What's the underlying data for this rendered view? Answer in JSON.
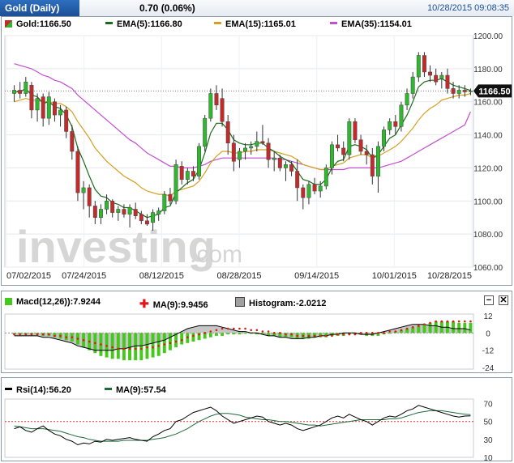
{
  "header": {
    "title": "Gold (Daily)",
    "change": "0.70 (0.06%)",
    "timestamp": "10/28/2015 09:08:35"
  },
  "main_legend": {
    "price": "Gold:1166.50",
    "ema5": "EMA(5):1166.80",
    "ema15": "EMA(15):1165.01",
    "ema35": "EMA(35):1154.01"
  },
  "price_tag": "1166.50",
  "watermark": {
    "brand": "investing",
    "suffix": ".com"
  },
  "macd_legend": {
    "macd": "Macd(12,26)):7.9244",
    "ma": "MA(9):9.9456",
    "histogram": "Histogram:-2.0212"
  },
  "rsi_legend": {
    "rsi": "Rsi(14):56.20",
    "ma": "MA(9):57.54"
  },
  "controls": {
    "minus": "−",
    "close": "✕"
  },
  "colors": {
    "up": "#2db82d",
    "down": "#c42a2a",
    "ema5": "#1a6b1a",
    "ema15": "#d4a020",
    "ema35": "#c24fd0",
    "histogram": "#45c81c",
    "macd_signal": "#e01818",
    "rsi": "#000000",
    "rsi_ma": "#1e6b3a",
    "title_bg": "#1e5aa8"
  },
  "chart_data": [
    {
      "type": "candlestick",
      "title": "Gold (Daily)",
      "ylim": [
        1060,
        1200
      ],
      "yticks": [
        1060,
        1080,
        1100,
        1120,
        1140,
        1160,
        1180,
        1200
      ],
      "xticks": [
        "07/02/2015",
        "07/24/2015",
        "08/12/2015",
        "08/28/2015",
        "09/14/2015",
        "10/01/2015",
        "10/28/2015"
      ],
      "last_price": 1166.5,
      "ohlc": [
        [
          1165,
          1170,
          1160,
          1167
        ],
        [
          1167,
          1172,
          1162,
          1165
        ],
        [
          1165,
          1175,
          1163,
          1172
        ],
        [
          1170,
          1172,
          1150,
          1155
        ],
        [
          1155,
          1165,
          1148,
          1162
        ],
        [
          1163,
          1165,
          1145,
          1150
        ],
        [
          1150,
          1166,
          1146,
          1163
        ],
        [
          1160,
          1162,
          1148,
          1152
        ],
        [
          1152,
          1158,
          1145,
          1155
        ],
        [
          1155,
          1157,
          1138,
          1142
        ],
        [
          1142,
          1146,
          1125,
          1130
        ],
        [
          1130,
          1133,
          1100,
          1105
        ],
        [
          1105,
          1112,
          1095,
          1108
        ],
        [
          1108,
          1110,
          1090,
          1097
        ],
        [
          1097,
          1100,
          1086,
          1090
        ],
        [
          1090,
          1098,
          1086,
          1095
        ],
        [
          1095,
          1104,
          1092,
          1100
        ],
        [
          1100,
          1101,
          1090,
          1093
        ],
        [
          1093,
          1097,
          1088,
          1095
        ],
        [
          1095,
          1098,
          1090,
          1092
        ],
        [
          1092,
          1098,
          1084,
          1096
        ],
        [
          1095,
          1099,
          1089,
          1091
        ],
        [
          1092,
          1094,
          1086,
          1088
        ],
        [
          1088,
          1092,
          1085,
          1086
        ],
        [
          1087,
          1095,
          1082,
          1093
        ],
        [
          1092,
          1096,
          1088,
          1094
        ],
        [
          1094,
          1106,
          1092,
          1104
        ],
        [
          1104,
          1108,
          1098,
          1100
        ],
        [
          1100,
          1125,
          1098,
          1122
        ],
        [
          1121,
          1124,
          1110,
          1113
        ],
        [
          1113,
          1120,
          1110,
          1118
        ],
        [
          1118,
          1121,
          1112,
          1115
        ],
        [
          1115,
          1135,
          1113,
          1133
        ],
        [
          1133,
          1152,
          1130,
          1150
        ],
        [
          1150,
          1168,
          1148,
          1165
        ],
        [
          1165,
          1170,
          1155,
          1158
        ],
        [
          1162,
          1168,
          1145,
          1148
        ],
        [
          1148,
          1152,
          1128,
          1135
        ],
        [
          1135,
          1140,
          1118,
          1124
        ],
        [
          1125,
          1132,
          1120,
          1130
        ],
        [
          1130,
          1135,
          1125,
          1132
        ],
        [
          1132,
          1136,
          1128,
          1133
        ],
        [
          1133,
          1142,
          1130,
          1136
        ],
        [
          1136,
          1146,
          1134,
          1135
        ],
        [
          1135,
          1138,
          1120,
          1125
        ],
        [
          1125,
          1130,
          1118,
          1126
        ],
        [
          1126,
          1128,
          1118,
          1120
        ],
        [
          1120,
          1124,
          1112,
          1122
        ],
        [
          1122,
          1124,
          1115,
          1118
        ],
        [
          1118,
          1125,
          1100,
          1108
        ],
        [
          1108,
          1110,
          1095,
          1102
        ],
        [
          1102,
          1112,
          1098,
          1110
        ],
        [
          1110,
          1114,
          1104,
          1106
        ],
        [
          1106,
          1112,
          1102,
          1109
        ],
        [
          1109,
          1122,
          1107,
          1120
        ],
        [
          1120,
          1136,
          1116,
          1134
        ],
        [
          1134,
          1140,
          1130,
          1132
        ],
        [
          1132,
          1136,
          1124,
          1128
        ],
        [
          1128,
          1150,
          1125,
          1148
        ],
        [
          1148,
          1150,
          1135,
          1137
        ],
        [
          1137,
          1140,
          1128,
          1130
        ],
        [
          1130,
          1134,
          1122,
          1128
        ],
        [
          1128,
          1132,
          1110,
          1115
        ],
        [
          1115,
          1136,
          1105,
          1133
        ],
        [
          1133,
          1145,
          1130,
          1143
        ],
        [
          1143,
          1150,
          1140,
          1148
        ],
        [
          1148,
          1152,
          1140,
          1145
        ],
        [
          1145,
          1160,
          1142,
          1158
        ],
        [
          1158,
          1168,
          1155,
          1165
        ],
        [
          1165,
          1178,
          1162,
          1175
        ],
        [
          1175,
          1190,
          1172,
          1188
        ],
        [
          1188,
          1190,
          1175,
          1178
        ],
        [
          1178,
          1182,
          1172,
          1176
        ],
        [
          1176,
          1180,
          1170,
          1172
        ],
        [
          1174,
          1178,
          1168,
          1176
        ],
        [
          1176,
          1180,
          1165,
          1168
        ],
        [
          1168,
          1172,
          1162,
          1165
        ],
        [
          1165,
          1170,
          1162,
          1167
        ],
        [
          1167,
          1170,
          1163,
          1166
        ],
        [
          1166,
          1168,
          1164,
          1166.5
        ]
      ],
      "series": [
        {
          "name": "EMA(5)",
          "values": [
            1166,
            1166,
            1168,
            1164,
            1163,
            1159,
            1160,
            1157,
            1156,
            1152,
            1145,
            1132,
            1124,
            1115,
            1107,
            1103,
            1102,
            1099,
            1098,
            1096,
            1096,
            1094,
            1092,
            1090,
            1091,
            1092,
            1096,
            1097,
            1105,
            1108,
            1111,
            1113,
            1119,
            1129,
            1141,
            1147,
            1147,
            1143,
            1137,
            1135,
            1134,
            1134,
            1135,
            1135,
            1132,
            1130,
            1127,
            1125,
            1123,
            1118,
            1113,
            1112,
            1110,
            1110,
            1113,
            1120,
            1124,
            1125,
            1133,
            1134,
            1133,
            1131,
            1126,
            1128,
            1133,
            1138,
            1140,
            1146,
            1152,
            1160,
            1169,
            1172,
            1173,
            1173,
            1174,
            1172,
            1170,
            1169,
            1168,
            1166.8
          ]
        },
        {
          "name": "EMA(15)",
          "values": [
            1160,
            1161,
            1162,
            1161,
            1161,
            1160,
            1160,
            1159,
            1159,
            1157,
            1154,
            1148,
            1143,
            1138,
            1132,
            1128,
            1124,
            1121,
            1118,
            1115,
            1113,
            1111,
            1108,
            1106,
            1105,
            1104,
            1104,
            1103,
            1106,
            1107,
            1108,
            1109,
            1112,
            1117,
            1123,
            1127,
            1130,
            1130,
            1129,
            1129,
            1130,
            1130,
            1131,
            1131,
            1131,
            1130,
            1129,
            1128,
            1127,
            1125,
            1122,
            1121,
            1120,
            1119,
            1119,
            1121,
            1122,
            1123,
            1126,
            1127,
            1128,
            1128,
            1126,
            1127,
            1129,
            1131,
            1133,
            1136,
            1140,
            1144,
            1149,
            1153,
            1156,
            1158,
            1161,
            1162,
            1163,
            1164,
            1164,
            1165.01
          ]
        },
        {
          "name": "EMA(35)",
          "values": [
            1183,
            1182,
            1181,
            1180,
            1178,
            1176,
            1175,
            1173,
            1172,
            1170,
            1168,
            1164,
            1161,
            1158,
            1155,
            1152,
            1149,
            1146,
            1143,
            1140,
            1137,
            1135,
            1132,
            1129,
            1127,
            1125,
            1123,
            1121,
            1121,
            1120,
            1120,
            1120,
            1121,
            1122,
            1124,
            1125,
            1126,
            1126,
            1126,
            1126,
            1126,
            1126,
            1126,
            1126,
            1126,
            1126,
            1125,
            1125,
            1124,
            1123,
            1122,
            1121,
            1120,
            1119,
            1119,
            1119,
            1119,
            1119,
            1120,
            1120,
            1120,
            1120,
            1120,
            1120,
            1121,
            1122,
            1123,
            1124,
            1126,
            1128,
            1130,
            1132,
            1134,
            1136,
            1138,
            1140,
            1142,
            1144,
            1146,
            1154.01
          ]
        }
      ]
    },
    {
      "type": "bar",
      "title": "Macd(12,26))",
      "ylim": [
        -24,
        12
      ],
      "yticks": [
        12,
        0,
        -12,
        -24
      ],
      "series": [
        {
          "name": "Histogram",
          "values": [
            -1,
            -1,
            -1,
            -1,
            -1,
            -2,
            -2,
            -3,
            -4,
            -5,
            -6,
            -8,
            -10,
            -12,
            -14,
            -16,
            -17,
            -18,
            -18,
            -19,
            -19,
            -19,
            -19,
            -18,
            -17,
            -16,
            -14,
            -12,
            -10,
            -8,
            -7,
            -6,
            -5,
            -4,
            -3,
            -2,
            -2,
            -1,
            -1,
            -1,
            0,
            0,
            -1,
            -1,
            -2,
            -2,
            -3,
            -3,
            -3,
            -4,
            -4,
            -4,
            -3,
            -3,
            -3,
            -2,
            -2,
            -2,
            -1,
            -1,
            -1,
            -2,
            -2,
            -2,
            -1,
            0,
            1,
            2,
            3,
            4,
            5,
            6,
            7,
            8,
            8,
            8,
            8,
            7,
            7,
            7
          ]
        },
        {
          "name": "MACD",
          "values": [
            -2,
            -2,
            -2,
            -2,
            -2,
            -3,
            -3,
            -4,
            -5,
            -6,
            -7,
            -9,
            -10,
            -11,
            -12,
            -12,
            -12,
            -12,
            -11,
            -11,
            -10,
            -9,
            -9,
            -8,
            -7,
            -6,
            -5,
            -3,
            -1,
            1,
            3,
            4,
            5,
            5,
            5,
            5,
            4,
            3,
            2,
            1,
            1,
            0,
            0,
            -1,
            -2,
            -2,
            -3,
            -3,
            -4,
            -4,
            -4,
            -3,
            -3,
            -2,
            -2,
            -1,
            -1,
            0,
            0,
            0,
            -1,
            -1,
            -1,
            0,
            1,
            2,
            3,
            4,
            5,
            6,
            6,
            6,
            5,
            5,
            4,
            4,
            3,
            3,
            3,
            2
          ]
        },
        {
          "name": "MA(9)",
          "values": [
            -1,
            -1,
            -1,
            -1,
            -1,
            -1,
            -1,
            -2,
            -2,
            -3,
            -3,
            -4,
            -5,
            -6,
            -7,
            -8,
            -9,
            -10,
            -11,
            -11,
            -11,
            -11,
            -11,
            -10,
            -10,
            -9,
            -8,
            -7,
            -6,
            -5,
            -3,
            -2,
            -1,
            0,
            1,
            2,
            3,
            3,
            3,
            3,
            3,
            2,
            2,
            1,
            1,
            0,
            0,
            -1,
            -1,
            -2,
            -2,
            -2,
            -2,
            -2,
            -2,
            -2,
            -1,
            -1,
            -1,
            -1,
            0,
            0,
            0,
            0,
            0,
            1,
            1,
            2,
            3,
            4,
            5,
            6,
            7,
            8,
            8,
            8,
            8,
            8,
            8,
            8
          ]
        }
      ]
    },
    {
      "type": "line",
      "title": "Rsi(14)",
      "ylim": [
        10,
        75
      ],
      "yticks": [
        70,
        50,
        30,
        10
      ],
      "series": [
        {
          "name": "Rsi(14)",
          "values": [
            42,
            44,
            40,
            38,
            42,
            45,
            40,
            36,
            34,
            30,
            28,
            24,
            26,
            25,
            28,
            27,
            30,
            29,
            30,
            31,
            32,
            30,
            29,
            28,
            33,
            36,
            40,
            42,
            50,
            52,
            56,
            60,
            62,
            64,
            66,
            62,
            56,
            52,
            48,
            50,
            52,
            54,
            56,
            55,
            50,
            48,
            46,
            48,
            46,
            42,
            40,
            42,
            44,
            46,
            50,
            54,
            56,
            54,
            58,
            55,
            52,
            50,
            46,
            50,
            54,
            56,
            55,
            58,
            62,
            64,
            68,
            66,
            64,
            62,
            60,
            58,
            56,
            55,
            56,
            56.2
          ]
        },
        {
          "name": "MA(9)",
          "values": [
            45,
            44,
            43,
            42,
            42,
            42,
            41,
            40,
            39,
            37,
            35,
            33,
            32,
            30,
            29,
            28,
            28,
            28,
            28,
            29,
            29,
            29,
            29,
            29,
            30,
            31,
            32,
            34,
            36,
            39,
            42,
            46,
            50,
            53,
            56,
            58,
            59,
            59,
            58,
            57,
            55,
            54,
            53,
            52,
            52,
            51,
            50,
            50,
            49,
            48,
            47,
            46,
            46,
            45,
            46,
            47,
            48,
            49,
            50,
            51,
            52,
            52,
            52,
            52,
            52,
            53,
            53,
            54,
            56,
            58,
            60,
            61,
            62,
            62,
            62,
            61,
            60,
            59,
            58,
            57.54
          ]
        }
      ]
    }
  ]
}
